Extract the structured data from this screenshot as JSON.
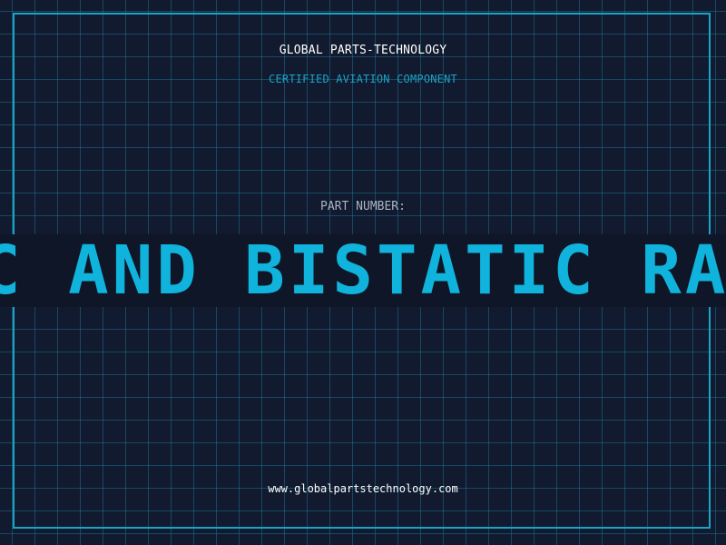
{
  "header": {
    "company_name": "GLOBAL PARTS-TECHNOLOGY",
    "subtitle": "CERTIFIED AVIATION COMPONENT"
  },
  "part": {
    "label": "PART NUMBER:",
    "number": "C AND BISTATIC RADA"
  },
  "footer": {
    "website": "www.globalpartstechnology.com"
  },
  "colors": {
    "background": "#111a2e",
    "accent": "#1aa3c7",
    "part_number": "#10b3dc",
    "label_gray": "#aab4c4"
  }
}
